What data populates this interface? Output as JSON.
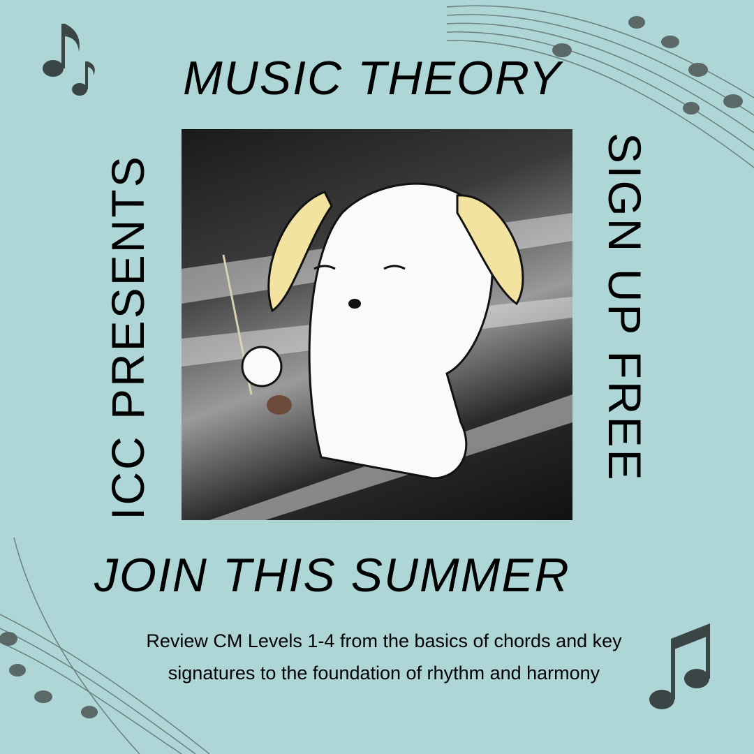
{
  "poster": {
    "title": "MUSIC THEORY",
    "left_vertical": "ICC PRESENTS",
    "right_vertical": "SIGN UP FREE",
    "subtitle": "JOIN THIS SUMMER",
    "description": "Review CM Levels 1-4 from the basics of chords and key signatures to the foundation of rhythm and harmony"
  },
  "colors": {
    "background": "#aed6d6",
    "notes": "#4f5f5f",
    "text": "#000000"
  },
  "icons": [
    "music-note-icon",
    "music-staff-icon",
    "puppy-conductor-illustration",
    "piano-keys-photo"
  ]
}
